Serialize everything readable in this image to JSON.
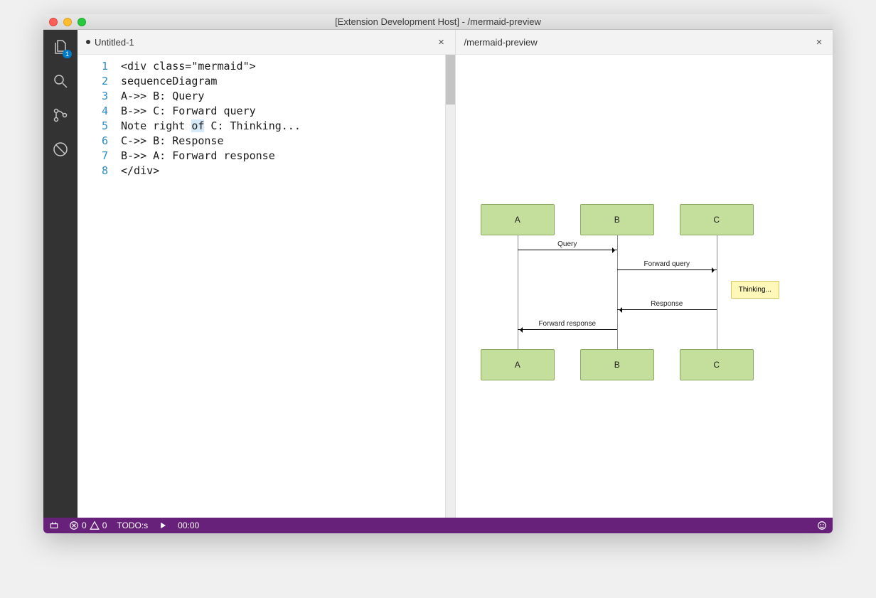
{
  "window": {
    "title": "[Extension Development Host] - /mermaid-preview"
  },
  "activitybar": {
    "files_badge": "1"
  },
  "editor": {
    "tab_label": "Untitled-1",
    "is_dirty": true,
    "line_numbers": [
      "1",
      "2",
      "3",
      "4",
      "5",
      "6",
      "7",
      "8"
    ],
    "lines": [
      "<div class=\"mermaid\">",
      "sequenceDiagram",
      "A->> B: Query",
      "B->> C: Forward query",
      "Note right of C: Thinking...",
      "C->> B: Response",
      "B->> A: Forward response",
      "</div>"
    ],
    "highlighted_token": "of"
  },
  "preview": {
    "tab_label": "/mermaid-preview",
    "actors": [
      "A",
      "B",
      "C"
    ],
    "messages": [
      {
        "from": "A",
        "to": "B",
        "label": "Query"
      },
      {
        "from": "B",
        "to": "C",
        "label": "Forward query"
      },
      {
        "from": "C",
        "to": "B",
        "label": "Response"
      },
      {
        "from": "B",
        "to": "A",
        "label": "Forward response"
      }
    ],
    "note": {
      "text": "Thinking...",
      "attach": "C"
    }
  },
  "statusbar": {
    "errors": "0",
    "warnings": "0",
    "todo": "TODO:s",
    "timer": "00:00"
  },
  "chart_data": {
    "type": "sequence-diagram",
    "actors": [
      "A",
      "B",
      "C"
    ],
    "steps": [
      {
        "type": "message",
        "from": "A",
        "to": "B",
        "text": "Query"
      },
      {
        "type": "message",
        "from": "B",
        "to": "C",
        "text": "Forward query"
      },
      {
        "type": "note",
        "position": "right of",
        "actor": "C",
        "text": "Thinking..."
      },
      {
        "type": "message",
        "from": "C",
        "to": "B",
        "text": "Response"
      },
      {
        "type": "message",
        "from": "B",
        "to": "A",
        "text": "Forward response"
      }
    ]
  }
}
